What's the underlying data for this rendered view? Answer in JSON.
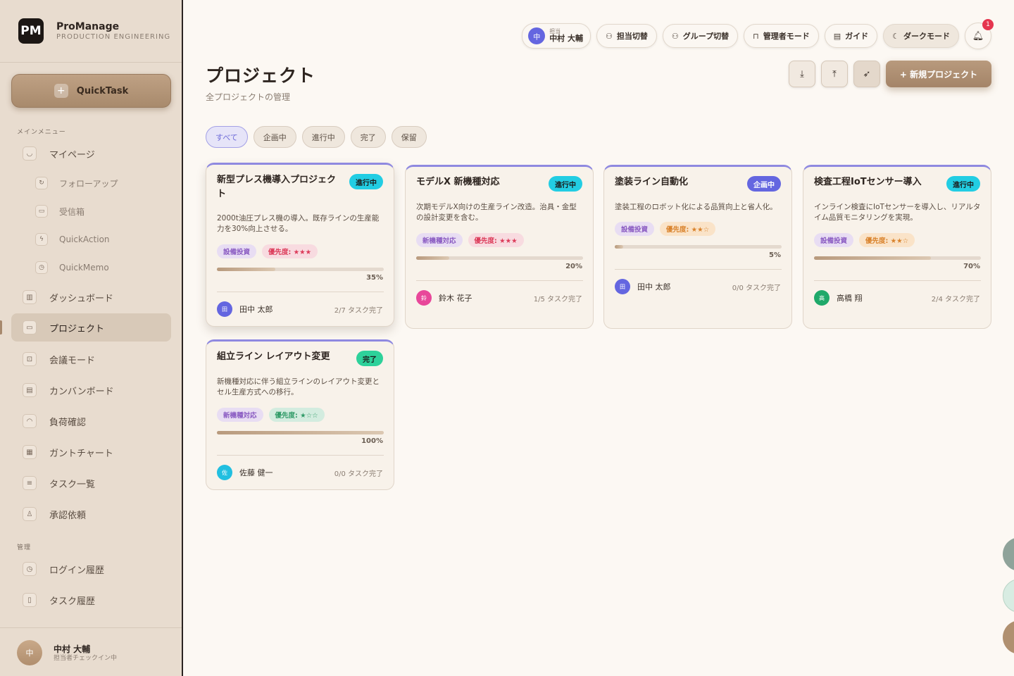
{
  "app": {
    "name": "ProManage",
    "subtitle": "PRODUCTION ENGINEERING",
    "logo": "PM"
  },
  "sidebar": {
    "quicktask_label": "QuickTask",
    "main_menu_label": "メインメニュー",
    "admin_label": "管理",
    "items": {
      "mypage": {
        "label": "マイページ",
        "icon": "person-icon"
      },
      "followup": {
        "label": "フォローアップ",
        "icon": "refresh-icon"
      },
      "inbox": {
        "label": "受信箱",
        "icon": "inbox-icon"
      },
      "quickaction": {
        "label": "QuickAction",
        "icon": "lightning-icon"
      },
      "quickmemo": {
        "label": "QuickMemo",
        "icon": "clock-icon"
      },
      "dashboard": {
        "label": "ダッシュボード",
        "icon": "chart-icon"
      },
      "projects": {
        "label": "プロジェクト",
        "icon": "folder-icon"
      },
      "meeting": {
        "label": "会議モード",
        "icon": "presentation-icon"
      },
      "kanban": {
        "label": "カンバンボード",
        "icon": "kanban-icon"
      },
      "workload": {
        "label": "負荷確認",
        "icon": "gauge-icon"
      },
      "gantt": {
        "label": "ガントチャート",
        "icon": "calendar-icon"
      },
      "tasklist": {
        "label": "タスク一覧",
        "icon": "list-icon"
      },
      "approval": {
        "label": "承認依頼",
        "icon": "stamp-icon"
      },
      "loginhistory": {
        "label": "ログイン履歴",
        "icon": "history-icon"
      },
      "taskhistory": {
        "label": "タスク履歴",
        "icon": "document-icon"
      }
    },
    "footer": {
      "avatar": "中",
      "name": "中村 大輔",
      "status": "担当者チェックイン中"
    }
  },
  "topbar": {
    "user_avatar": "中",
    "user_label": "担当",
    "user_name": "中村 大輔",
    "switch_assignee": "担当切替",
    "switch_group": "グループ切替",
    "admin_mode": "管理者モード",
    "guide": "ガイド",
    "dark_mode": "ダークモード",
    "notification_count": "1"
  },
  "page": {
    "title": "プロジェクト",
    "subtitle": "全プロジェクトの管理",
    "new_project": "+ 新規プロジェクト"
  },
  "filters": [
    "すべて",
    "企画中",
    "進行中",
    "完了",
    "保留"
  ],
  "projects": [
    {
      "title": "新型プレス機導入プロジェクト",
      "status": "進行中",
      "description": "2000t油圧プレス機の導入。既存ラインの生産能力を30%向上させる。",
      "category": "設備投資",
      "priority": "優先度: ★★★",
      "progress": 35,
      "progress_label": "35%",
      "owner_initial": "田",
      "owner": "田中 太郎",
      "tasks": "2/7 タスク完了"
    },
    {
      "title": "モデルX 新機種対応",
      "status": "進行中",
      "description": "次期モデルX向けの生産ライン改造。治具・金型の設計変更を含む。",
      "category": "新機種対応",
      "priority": "優先度: ★★★",
      "progress": 20,
      "progress_label": "20%",
      "owner_initial": "鈴",
      "owner": "鈴木 花子",
      "tasks": "1/5 タスク完了"
    },
    {
      "title": "塗装ライン自動化",
      "status": "企画中",
      "description": "塗装工程のロボット化による品質向上と省人化。",
      "category": "設備投資",
      "priority": "優先度: ★★☆",
      "progress": 5,
      "progress_label": "5%",
      "owner_initial": "田",
      "owner": "田中 太郎",
      "tasks": "0/0 タスク完了"
    },
    {
      "title": "検査工程IoTセンサー導入",
      "status": "進行中",
      "description": "インライン検査にIoTセンサーを導入し、リアルタイム品質モニタリングを実現。",
      "category": "設備投資",
      "priority": "優先度: ★★☆",
      "progress": 70,
      "progress_label": "70%",
      "owner_initial": "高",
      "owner": "高橋 翔",
      "tasks": "2/4 タスク完了"
    },
    {
      "title": "組立ライン レイアウト変更",
      "status": "完了",
      "description": "新機種対応に伴う組立ラインのレイアウト変更とセル生産方式への移行。",
      "category": "新機種対応",
      "priority": "優先度: ★☆☆",
      "progress": 100,
      "progress_label": "100%",
      "owner_initial": "佐",
      "owner": "佐藤 健一",
      "tasks": "0/0 タスク完了"
    }
  ],
  "colors": {
    "accent": "#a88a6c",
    "status_in_progress": "#22cde3",
    "status_planning": "#6466e0",
    "status_done": "#2ed19a",
    "notification": "#e5364f"
  }
}
